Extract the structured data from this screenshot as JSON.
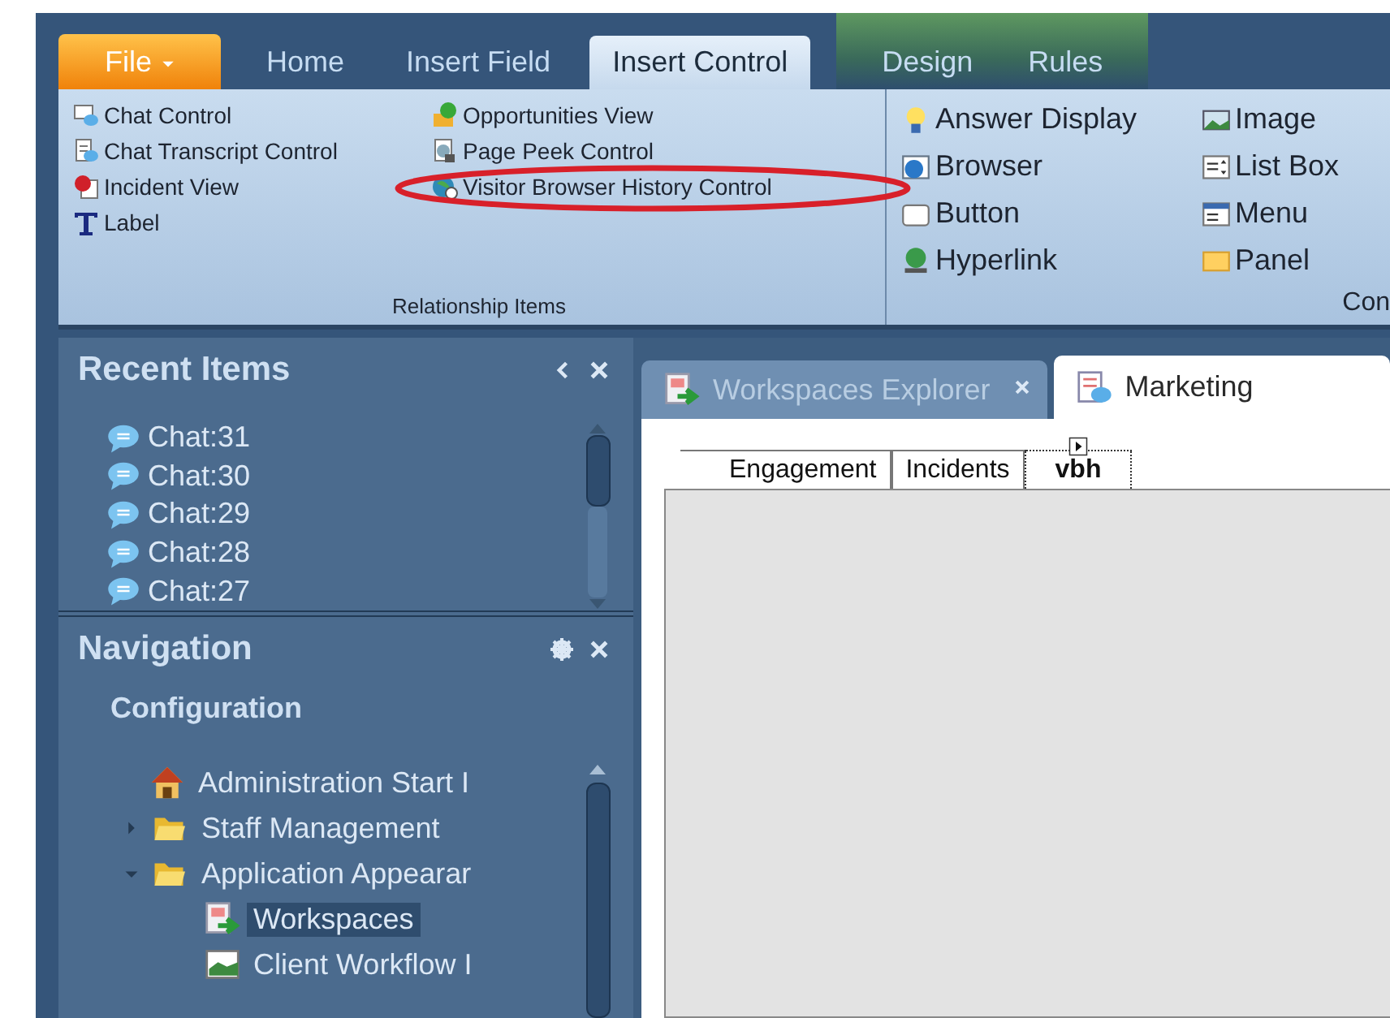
{
  "ribbon": {
    "tabs": [
      {
        "label": "File",
        "kind": "file",
        "selected": false
      },
      {
        "label": "Home",
        "kind": "tab",
        "selected": false
      },
      {
        "label": "Insert Field",
        "kind": "tab",
        "selected": false
      },
      {
        "label": "Insert Control",
        "kind": "tab",
        "selected": true
      },
      {
        "label": "Design",
        "kind": "context",
        "selected": false
      },
      {
        "label": "Rules",
        "kind": "context",
        "selected": false
      }
    ],
    "groups": [
      {
        "label": "Relationship Items",
        "items": [
          {
            "label": "Chat Control",
            "highlighted": false
          },
          {
            "label": "Chat Transcript Control",
            "highlighted": false
          },
          {
            "label": "Incident View",
            "highlighted": false
          },
          {
            "label": "Label",
            "highlighted": false
          },
          {
            "label": "Opportunities View",
            "highlighted": false
          },
          {
            "label": "Page Peek Control",
            "highlighted": false
          },
          {
            "label": "Visitor Browser History Control",
            "highlighted": true
          }
        ]
      },
      {
        "label": "Con",
        "items": [
          {
            "label": "Answer Display",
            "highlighted": false
          },
          {
            "label": "Browser",
            "highlighted": false
          },
          {
            "label": "Button",
            "highlighted": false
          },
          {
            "label": "Hyperlink",
            "highlighted": false
          },
          {
            "label": "Image",
            "highlighted": false
          },
          {
            "label": "List Box",
            "highlighted": false
          },
          {
            "label": "Menu",
            "highlighted": false
          },
          {
            "label": "Panel",
            "highlighted": false
          }
        ]
      }
    ]
  },
  "recent_items": {
    "title": "Recent Items",
    "items": [
      "Chat:31",
      "Chat:30",
      "Chat:29",
      "Chat:28",
      "Chat:27"
    ]
  },
  "navigation": {
    "title": "Navigation",
    "section": "Configuration",
    "tree": [
      {
        "label": "Administration Start I",
        "kind": "page",
        "selected": false
      },
      {
        "label": "Staff Management",
        "kind": "folder",
        "expanded": false,
        "selected": false
      },
      {
        "label": "Application Appearar",
        "kind": "folder",
        "expanded": true,
        "selected": false,
        "children": [
          {
            "label": "Workspaces",
            "kind": "page",
            "selected": true
          },
          {
            "label": "Client Workflow I",
            "kind": "page",
            "selected": false
          }
        ]
      }
    ]
  },
  "document_tabs": [
    {
      "label": "Workspaces Explorer",
      "selected": false,
      "closable": true
    },
    {
      "label": "Marketing",
      "selected": true,
      "closable": false
    }
  ],
  "designer_tabs": [
    {
      "label": "Engagement",
      "selected": false
    },
    {
      "label": "Incidents",
      "selected": false
    },
    {
      "label": "vbh",
      "selected": true
    }
  ]
}
